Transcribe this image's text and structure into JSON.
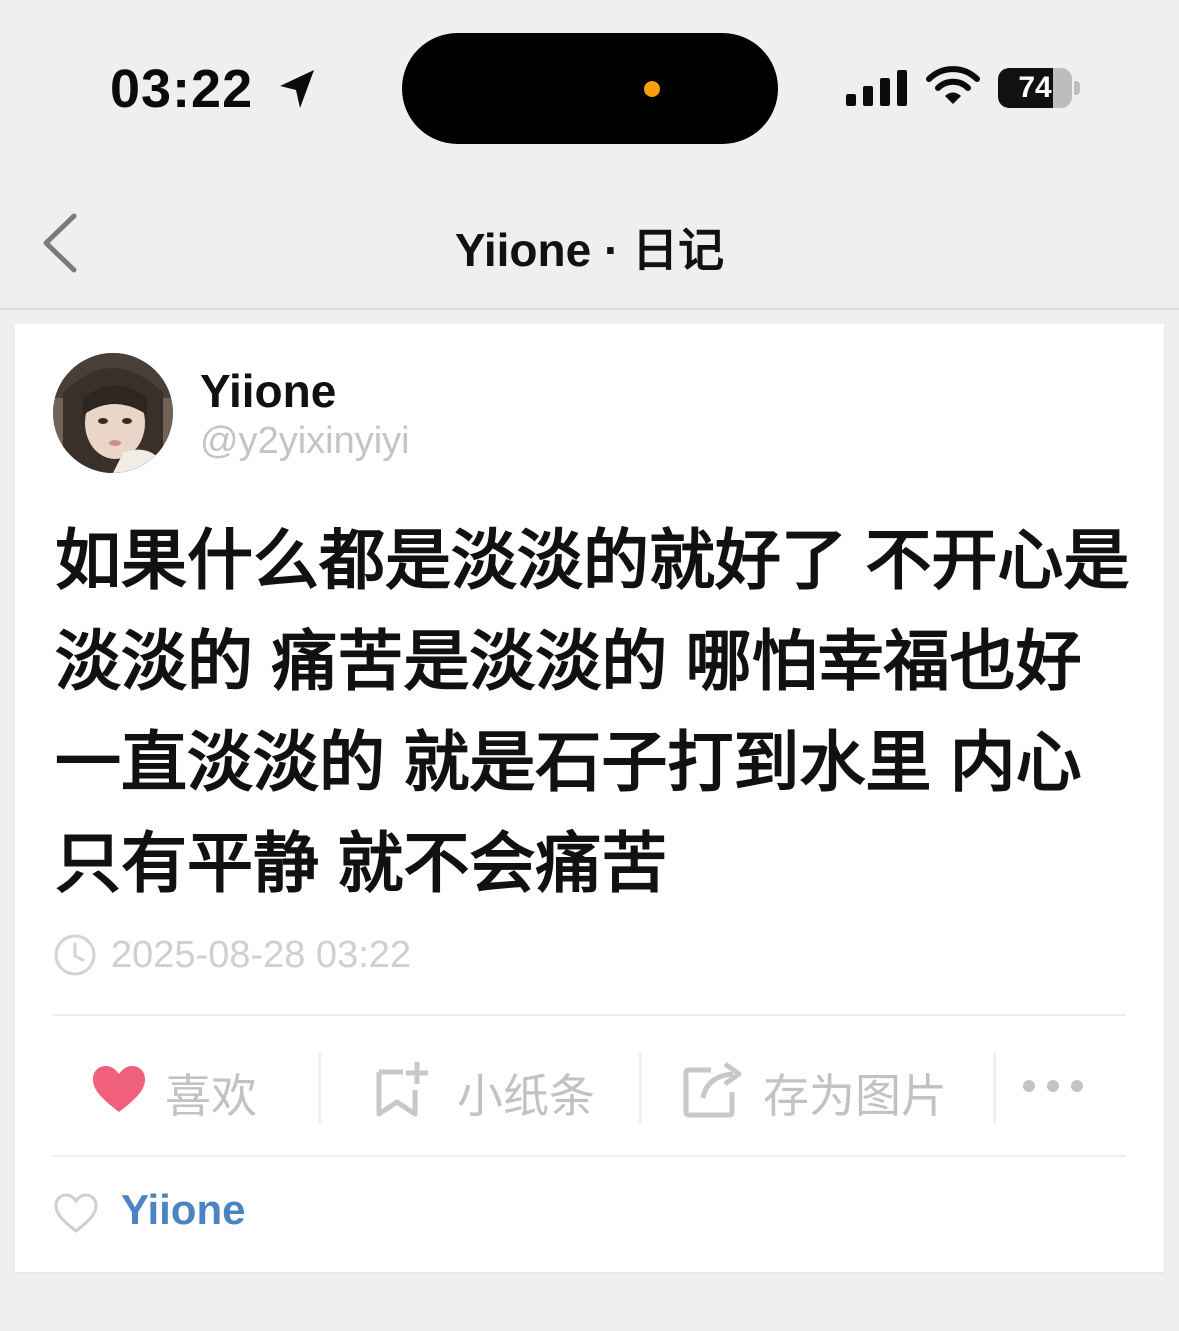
{
  "status_bar": {
    "time": "03:22",
    "battery": "74",
    "battery_level": 0.74
  },
  "nav": {
    "title": "Yiione · 日记"
  },
  "post": {
    "author_name": "Yiione",
    "author_handle": "@y2yixinyiyi",
    "body": "如果什么都是淡淡的就好了 不开心是淡淡的 痛苦是淡淡的 哪怕幸福也好一直淡淡的 就是石子打到水里 内心只有平静 就不会痛苦",
    "timestamp": "2025-08-28 03:22"
  },
  "actions": {
    "like_label": "喜欢",
    "note_label": "小纸条",
    "save_image_label": "存为图片",
    "like_color": "#f0607a"
  },
  "likes": {
    "liker": "Yiione",
    "liker_color": "#4c84c2"
  }
}
